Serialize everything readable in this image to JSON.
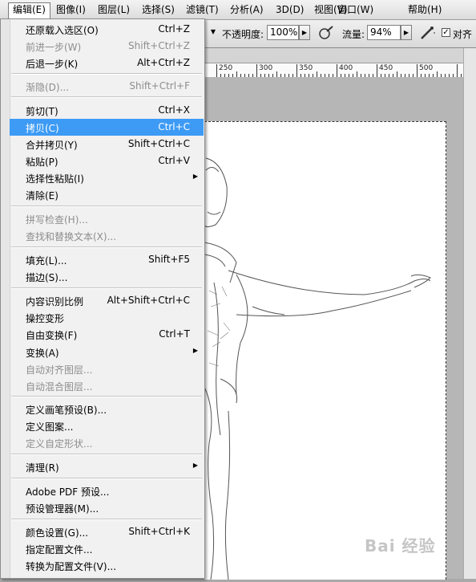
{
  "menubar": [
    "编辑(E)",
    "图像(I)",
    "图层(L)",
    "选择(S)",
    "滤镜(T)",
    "分析(A)",
    "3D(D)",
    "视图(V)",
    "窗口(W)",
    "帮助(H)"
  ],
  "options": {
    "opacity_label": "不透明度:",
    "opacity_value": "100%",
    "flow_label": "流量:",
    "flow_value": "94%",
    "align_label": "对齐",
    "align_checked": "✓"
  },
  "ruler": [
    "250",
    "300",
    "350",
    "400",
    "450",
    "500"
  ],
  "menu": {
    "items": [
      {
        "label": "还原载入选区(O)",
        "shortcut": "Ctrl+Z"
      },
      {
        "label": "前进一步(W)",
        "shortcut": "Shift+Ctrl+Z"
      },
      {
        "label": "后退一步(K)",
        "shortcut": "Alt+Ctrl+Z"
      },
      {
        "label": "渐隐(D)...",
        "shortcut": "Shift+Ctrl+F"
      },
      {
        "label": "剪切(T)",
        "shortcut": "Ctrl+X"
      },
      {
        "label": "拷贝(C)",
        "shortcut": "Ctrl+C"
      },
      {
        "label": "合并拷贝(Y)",
        "shortcut": "Shift+Ctrl+C"
      },
      {
        "label": "粘贴(P)",
        "shortcut": "Ctrl+V"
      },
      {
        "label": "选择性粘贴(I)",
        "shortcut": ""
      },
      {
        "label": "清除(E)",
        "shortcut": ""
      },
      {
        "label": "拼写检查(H)...",
        "shortcut": ""
      },
      {
        "label": "查找和替换文本(X)...",
        "shortcut": ""
      },
      {
        "label": "填充(L)...",
        "shortcut": "Shift+F5"
      },
      {
        "label": "描边(S)...",
        "shortcut": ""
      },
      {
        "label": "内容识别比例",
        "shortcut": "Alt+Shift+Ctrl+C"
      },
      {
        "label": "操控变形",
        "shortcut": ""
      },
      {
        "label": "自由变换(F)",
        "shortcut": "Ctrl+T"
      },
      {
        "label": "变换(A)",
        "shortcut": ""
      },
      {
        "label": "自动对齐图层...",
        "shortcut": ""
      },
      {
        "label": "自动混合图层...",
        "shortcut": ""
      },
      {
        "label": "定义画笔预设(B)...",
        "shortcut": ""
      },
      {
        "label": "定义图案...",
        "shortcut": ""
      },
      {
        "label": "定义自定形状...",
        "shortcut": ""
      },
      {
        "label": "清理(R)",
        "shortcut": ""
      },
      {
        "label": "Adobe PDF 预设...",
        "shortcut": ""
      },
      {
        "label": "预设管理器(M)...",
        "shortcut": ""
      },
      {
        "label": "颜色设置(G)...",
        "shortcut": "Shift+Ctrl+K"
      },
      {
        "label": "指定配置文件...",
        "shortcut": ""
      },
      {
        "label": "转换为配置文件(V)...",
        "shortcut": ""
      }
    ]
  },
  "watermark": "Bai 经验",
  "colors": {
    "highlight": "#3d9bf5",
    "disabled_text": "#8d8d8d",
    "menu_bg": "#f1f1f1"
  }
}
